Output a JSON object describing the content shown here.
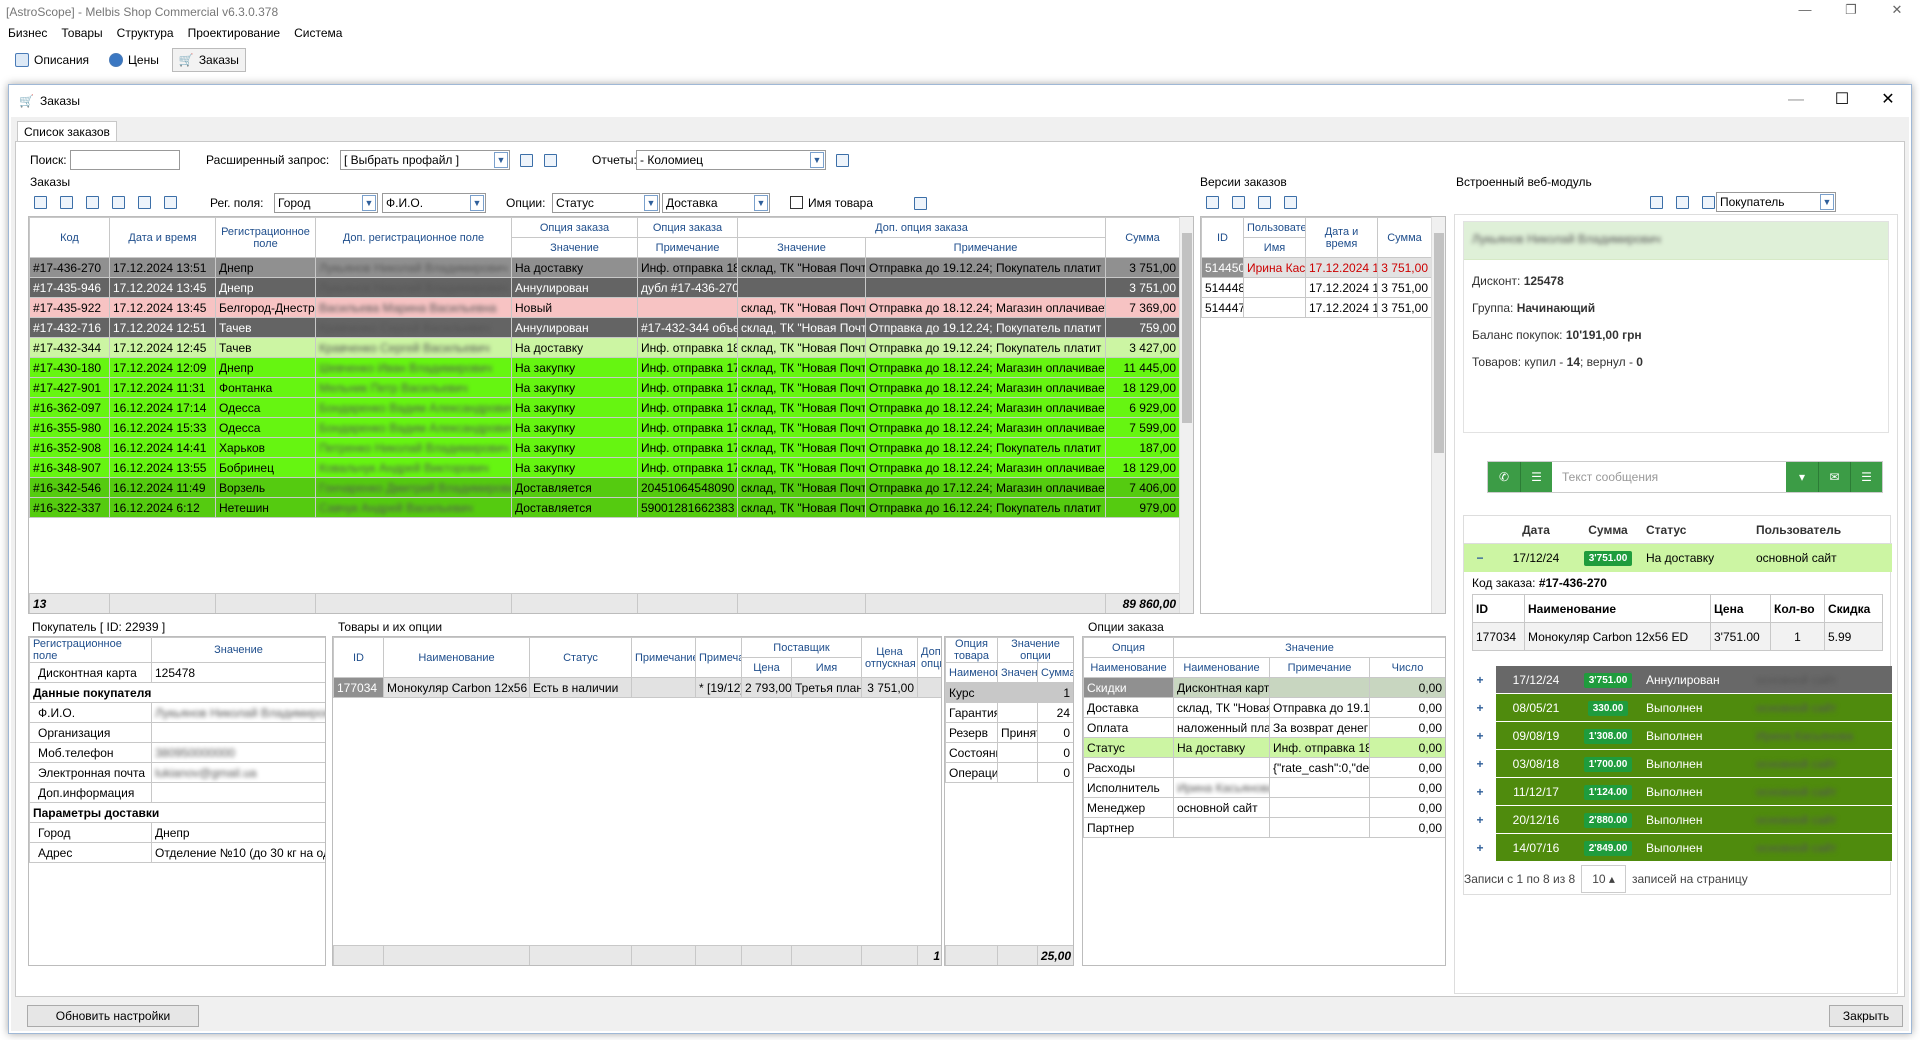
{
  "app": {
    "title": "[AstroScope] - Melbis Shop Commercial v6.3.0.378",
    "menu": [
      "Бизнес",
      "Товары",
      "Структура",
      "Проектирование",
      "Система"
    ],
    "tabs": [
      "Описания",
      "Цены",
      "Заказы"
    ]
  },
  "dialog": {
    "title": "Заказы",
    "tab": "Список заказов"
  },
  "filters": {
    "search_label": "Поиск:",
    "search_value": "",
    "ext_label": "Расширенный запрос:",
    "ext_value": "[ Выбрать профайл ]",
    "reports_label": "Отчеты:",
    "reports_value": "- Коломиец"
  },
  "orders": {
    "section": "Заказы",
    "reg_label": "Рег. поля:",
    "reg_value1": "Город",
    "reg_value2": "Ф.И.О.",
    "options_label": "Опции:",
    "opt_value1": "Статус",
    "opt_value2": "Доставка",
    "name_checkbox": "Имя товара",
    "headers": {
      "code": "Код",
      "date": "Дата и время",
      "reg": "Регистрационное поле",
      "extreg": "Доп. регистрационное поле",
      "opt1": "Опция заказа",
      "opt1_val": "Значение",
      "opt2": "Опция заказа",
      "opt2_note": "Примечание",
      "extopt": "Доп. опция заказа",
      "extopt_val": "Значение",
      "extopt_note": "Примечание",
      "sum": "Сумма"
    },
    "rows": [
      {
        "code": "#17-436-270",
        "date": "17.12.2024 13:51",
        "city": "Днепр",
        "fio": "Лукьянов Николай Владимирович",
        "status": "На доставку",
        "note": "Инф. отправка 18",
        "dval": "склад, ТК \"Новая Почта\"",
        "dnote": "Отправка до 19.12.24; Покупатель платит за",
        "sum": "3 751,00",
        "cls": "r-sel"
      },
      {
        "code": "#17-435-946",
        "date": "17.12.2024 13:45",
        "city": "Днепр",
        "fio": "Лукьянов Николай Владимирович",
        "status": "Аннулирован",
        "note": "дубл #17-436-270",
        "dval": "",
        "dnote": "",
        "sum": "3 751,00",
        "cls": "r-dark"
      },
      {
        "code": "#17-435-922",
        "date": "17.12.2024 13:45",
        "city": "Белгород-Днестро",
        "fio": "Васильева Марина Васильевна",
        "status": "Новый",
        "note": "",
        "dval": "склад, ТК \"Новая Почта\"",
        "dnote": "Отправка до 18.12.24; Магазин оплачивает",
        "sum": "7 369,00",
        "cls": "r-pink"
      },
      {
        "code": "#17-432-716",
        "date": "17.12.2024 12:51",
        "city": "Тачев",
        "fio": "Кравченко Сергей Васильевич",
        "status": "Аннулирован",
        "note": "#17-432-344 объе",
        "dval": "склад, ТК \"Новая Почта\"",
        "dnote": "Отправка до 19.12.24; Покупатель платит за",
        "sum": "759,00",
        "cls": "r-dark"
      },
      {
        "code": "#17-432-344",
        "date": "17.12.2024 12:45",
        "city": "Тачев",
        "fio": "Кравченко Сергей Васильевич",
        "status": "На доставку",
        "note": "Инф. отправка 18",
        "dval": "склад, ТК \"Новая Почта\"",
        "dnote": "Отправка до 19.12.24; Покупатель платит за",
        "sum": "3 427,00",
        "cls": "r-light"
      },
      {
        "code": "#17-430-180",
        "date": "17.12.2024 12:09",
        "city": "Днепр",
        "fio": "Шевченко Иван Владимирович",
        "status": "На закупку",
        "note": "Инф. отправка 17",
        "dval": "склад, ТК \"Новая Почта\"",
        "dnote": "Отправка до 18.12.24; Магазин оплачивает",
        "sum": "11 445,00",
        "cls": "r-bright"
      },
      {
        "code": "#17-427-901",
        "date": "17.12.2024 11:31",
        "city": "Фонтанка",
        "fio": "Мельник Петр Васильевич",
        "status": "На закупку",
        "note": "Инф. отправка 17",
        "dval": "склад, ТК \"Новая Почта\"",
        "dnote": "Отправка до 18.12.24; Магазин оплачивает",
        "sum": "18 129,00",
        "cls": "r-bright"
      },
      {
        "code": "#16-362-097",
        "date": "16.12.2024 17:14",
        "city": "Одесса",
        "fio": "Бондаренко Вадим Александрович",
        "status": "На закупку",
        "note": "Инф. отправка 17",
        "dval": "склад, ТК \"Новая Почта\"",
        "dnote": "Отправка до 18.12.24; Магазин оплачивает",
        "sum": "6 929,00",
        "cls": "r-bright"
      },
      {
        "code": "#16-355-980",
        "date": "16.12.2024 15:33",
        "city": "Одесса",
        "fio": "Бондаренко Вадим Александрович",
        "status": "На закупку",
        "note": "Инф. отправка 17",
        "dval": "склад, ТК \"Новая Почта\"",
        "dnote": "Отправка до 18.12.24; Магазин оплачивает",
        "sum": "7 599,00",
        "cls": "r-bright"
      },
      {
        "code": "#16-352-908",
        "date": "16.12.2024 14:41",
        "city": "Харьков",
        "fio": "Петренко Николай Владимирович",
        "status": "На закупку",
        "note": "Инф. отправка 17",
        "dval": "склад, ТК \"Новая Почта\"",
        "dnote": "Отправка до 18.12.24; Покупатель платит за",
        "sum": "187,00",
        "cls": "r-bright"
      },
      {
        "code": "#16-348-907",
        "date": "16.12.2024 13:55",
        "city": "Бобринец",
        "fio": "Ковальчук Андрей Викторович",
        "status": "На закупку",
        "note": "Инф. отправка 17",
        "dval": "склад, ТК \"Новая Почта\"",
        "dnote": "Отправка до 18.12.24; Магазин оплачивает",
        "sum": "18 129,00",
        "cls": "r-bright"
      },
      {
        "code": "#16-342-546",
        "date": "16.12.2024 11:49",
        "city": "Ворзель",
        "fio": "Гончаренко Дмитрий Владимирович",
        "status": "Доставляется",
        "note": "20451064548090",
        "dval": "склад, ТК \"Новая Почта\"",
        "dnote": "Отправка до 17.12.24; Магазин оплачивает",
        "sum": "7 406,00",
        "cls": "r-mid"
      },
      {
        "code": "#16-322-337",
        "date": "16.12.2024 6:12",
        "city": "Нетешин",
        "fio": "Савчук Андрей Васильевич",
        "status": "Доставляется",
        "note": "59001281662383",
        "dval": "склад, ТК \"Новая Почта\"",
        "dnote": "Отправка до 16.12.24; Покупатель платит за",
        "sum": "979,00",
        "cls": "r-mid"
      }
    ],
    "footer_count": "13",
    "footer_sum": "89 860,00"
  },
  "versions": {
    "section": "Версии заказов",
    "headers": {
      "id": "ID",
      "user": "Пользователь",
      "user2": "Имя",
      "date": "Дата и время",
      "sum": "Сумма"
    },
    "rows": [
      {
        "id": "514450",
        "name": "Ирина Каси",
        "date": "17.12.2024 13:5",
        "sum": "3 751,00"
      },
      {
        "id": "514448",
        "name": "",
        "date": "17.12.2024 13:5",
        "sum": "3 751,00"
      },
      {
        "id": "514447",
        "name": "",
        "date": "17.12.2024 13:5",
        "sum": "3 751,00"
      }
    ]
  },
  "buyer": {
    "section": "Покупатель [ ID: 22939 ]",
    "h_field": "Регистрационное поле",
    "h_value": "Значение",
    "rows": [
      {
        "k": "Дисконтная карта",
        "v": "125478",
        "b": false
      },
      {
        "k": "Данные покупателя",
        "v": "",
        "b": true
      },
      {
        "k": "Ф.И.О.",
        "v": "Лукьянов Николай Владимирович",
        "b": false,
        "blur": true
      },
      {
        "k": "Организация",
        "v": "",
        "b": false
      },
      {
        "k": "Моб.телефон",
        "v": "380950000000",
        "b": false,
        "blur": true
      },
      {
        "k": "Электронная почта",
        "v": "lukianov@gmail.ua",
        "b": false,
        "blur": true
      },
      {
        "k": "Доп.информация",
        "v": "",
        "b": false
      },
      {
        "k": "Параметры доставки",
        "v": "",
        "b": true
      },
      {
        "k": "Город",
        "v": "Днепр",
        "b": false
      },
      {
        "k": "Адрес",
        "v": "Отделение №10 (до 30 кг на од",
        "b": false
      }
    ]
  },
  "goods": {
    "section": "Товары и их опции",
    "headers": {
      "id": "ID",
      "name": "Наименование",
      "status": "Статус",
      "note": "Примечание",
      "note2": "Примечание",
      "supplier": "Поставщик",
      "price": "Цена",
      "sname": "Имя",
      "sale": "Цена отпускная",
      "extra": "Доп. опция"
    },
    "row": {
      "id": "177034",
      "name": "Монокуляр Carbon 12x56",
      "status": "Есть в наличии",
      "note": "",
      "note2": "* [19/12]",
      "price": "2 793,00",
      "sname": "Третья план",
      "sale": "3 751,00"
    },
    "footer": "1"
  },
  "goodopts": {
    "h1": "Опция товара",
    "h2": "Значение опции",
    "h3": "Наименование",
    "h4": "Значение",
    "h5": "Сумма",
    "rows": [
      {
        "k": "Курс",
        "v": "",
        "n": "1"
      },
      {
        "k": "Гарантия",
        "v": "",
        "n": "24"
      },
      {
        "k": "Резерв",
        "v": "Принят",
        "n": "0"
      },
      {
        "k": "Состояни",
        "v": "",
        "n": "0"
      },
      {
        "k": "Операци",
        "v": "",
        "n": "0"
      }
    ],
    "footer": "25,00"
  },
  "orderopts": {
    "section": "Опции заказа",
    "h_opt": "Опция",
    "h_val": "Значение",
    "h_name": "Наименование",
    "h_vname": "Наименование",
    "h_note": "Примечание",
    "h_num": "Число",
    "rows": [
      {
        "k": "Скидки",
        "v": "Дисконтная карт",
        "n": "",
        "x": "0,00",
        "c": "sel"
      },
      {
        "k": "Доставка",
        "v": "склад, ТК \"Новая",
        "n": "Отправка до 19.12",
        "x": "0,00",
        "c": ""
      },
      {
        "k": "Оплата",
        "v": "наложенный пла",
        "n": "За возврат денег",
        "x": "0,00",
        "c": ""
      },
      {
        "k": "Статус",
        "v": "На доставку",
        "n": "Инф. отправка 18",
        "x": "0,00",
        "c": "lg"
      },
      {
        "k": "Расходы",
        "v": "",
        "n": "{\"rate_cash\":0,\"del",
        "x": "0,00",
        "c": ""
      },
      {
        "k": "Исполнитель",
        "v": "Ирина Касьянова",
        "n": "",
        "x": "0,00",
        "c": "",
        "blur": true
      },
      {
        "k": "Менеджер",
        "v": "основной сайт",
        "n": "",
        "x": "0,00",
        "c": ""
      },
      {
        "k": "Партнер",
        "v": "",
        "n": "",
        "x": "0,00",
        "c": ""
      }
    ]
  },
  "web": {
    "section": "Встроенный веб-модуль",
    "role": "Покупатель",
    "name": "Лукьянов Николай Владимирович",
    "discount_label": "Дисконт:",
    "discount": "125478",
    "group_label": "Группа:",
    "group": "Начинающий",
    "balance_label": "Баланс покупок:",
    "balance": "10'191,00 грн",
    "goods_label": "Товаров: купил -",
    "bought": "14",
    "returned_label": "; вернул -",
    "returned": "0",
    "msg_placeholder": "Текст сообщения",
    "h_date": "Дата",
    "h_sum": "Сумма",
    "h_status": "Статус",
    "h_user": "Пользователь",
    "current": {
      "date": "17/12/24",
      "sum": "3'751.00",
      "status": "На доставку",
      "user": "основной сайт"
    },
    "code_label": "Код заказа:",
    "code": "#17-436-270",
    "d_id": "ID",
    "d_name": "Наименование",
    "d_price": "Цена",
    "d_qty": "Кол-во",
    "d_disc": "Скидка",
    "detail": {
      "id": "177034",
      "name": "Монокуляр Carbon 12x56 ED",
      "price": "3'751.00",
      "qty": "1",
      "disc": "5.99"
    },
    "history": [
      {
        "date": "17/12/24",
        "sum": "3'751.00",
        "status": "Аннулирован",
        "user": "основной сайт",
        "c": "#686868"
      },
      {
        "date": "08/05/21",
        "sum": "330.00",
        "status": "Выполнен",
        "user": "основной сайт",
        "c": "#4f8b0d"
      },
      {
        "date": "09/08/19",
        "sum": "1'308.00",
        "status": "Выполнен",
        "user": "Ирина Касьянова",
        "c": "#4f8b0d"
      },
      {
        "date": "03/08/18",
        "sum": "1'700.00",
        "status": "Выполнен",
        "user": "основной сайт",
        "c": "#4f8b0d"
      },
      {
        "date": "11/12/17",
        "sum": "1'124.00",
        "status": "Выполнен",
        "user": "основной сайт",
        "c": "#4f8b0d"
      },
      {
        "date": "20/12/16",
        "sum": "2'880.00",
        "status": "Выполнен",
        "user": "основной сайт",
        "c": "#4f8b0d"
      },
      {
        "date": "14/07/16",
        "sum": "2'849.00",
        "status": "Выполнен",
        "user": "основной сайт",
        "c": "#4f8b0d"
      }
    ],
    "pager_pre": "Записи с 1 по 8 из 8",
    "pager_size": "10 ▴",
    "pager_post": "записей на страницу"
  },
  "buttons": {
    "refresh": "Обновить настройки",
    "close": "Закрыть"
  }
}
